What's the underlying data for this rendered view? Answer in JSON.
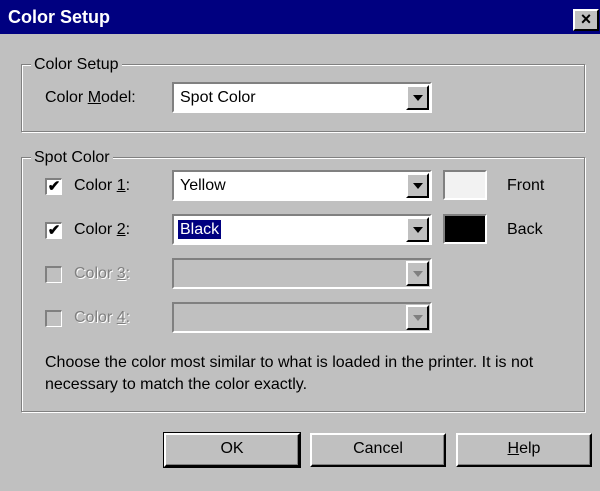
{
  "window": {
    "title": "Color Setup",
    "close_glyph": "×"
  },
  "color_setup_group": {
    "legend": "Color Setup",
    "model_label_pre": "Color ",
    "model_label_key": "M",
    "model_label_post": "odel:",
    "model_value": "Spot Color"
  },
  "spot_color_group": {
    "legend": "Spot Color",
    "rows": [
      {
        "label_pre": "Color ",
        "label_key": "1",
        "label_post": ":",
        "checked": true,
        "enabled": true,
        "value": "Yellow",
        "swatch": "#f2f2f2",
        "side": "Front"
      },
      {
        "label_pre": "Color ",
        "label_key": "2",
        "label_post": ":",
        "checked": true,
        "enabled": true,
        "value": "Black",
        "swatch": "#000000",
        "side": "Back"
      },
      {
        "label_pre": "Color ",
        "label_key": "3",
        "label_post": ":",
        "checked": false,
        "enabled": false,
        "value": ""
      },
      {
        "label_pre": "Color ",
        "label_key": "4",
        "label_post": ":",
        "checked": false,
        "enabled": false,
        "value": ""
      }
    ],
    "description": "Choose the color most similar to what is loaded in the printer.  It is not necessary to match the color exactly."
  },
  "buttons": {
    "ok": "OK",
    "cancel": "Cancel",
    "help_key": "H",
    "help_rest": "elp"
  },
  "check_glyph": "✔"
}
